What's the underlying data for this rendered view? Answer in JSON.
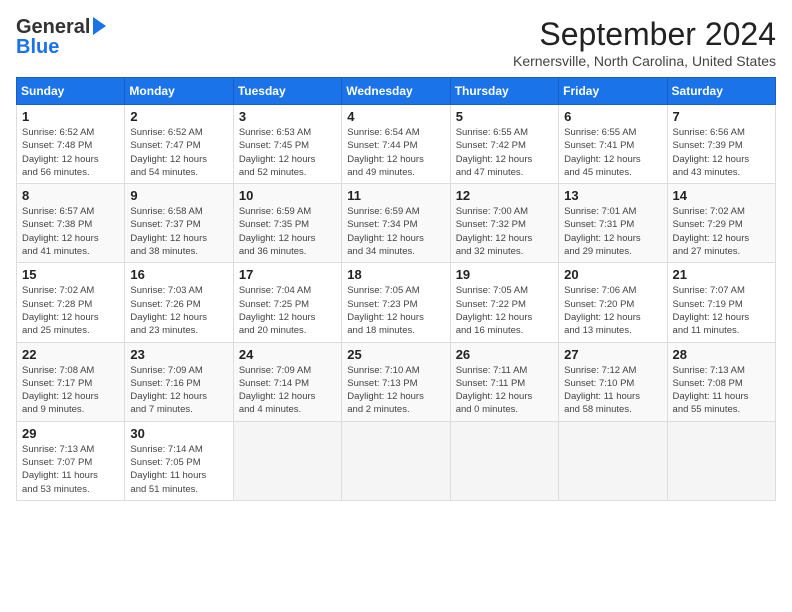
{
  "header": {
    "logo_line1": "General",
    "logo_line2": "Blue",
    "title": "September 2024",
    "subtitle": "Kernersville, North Carolina, United States"
  },
  "calendar": {
    "columns": [
      "Sunday",
      "Monday",
      "Tuesday",
      "Wednesday",
      "Thursday",
      "Friday",
      "Saturday"
    ],
    "weeks": [
      [
        {
          "day": "1",
          "info": "Sunrise: 6:52 AM\nSunset: 7:48 PM\nDaylight: 12 hours\nand 56 minutes."
        },
        {
          "day": "2",
          "info": "Sunrise: 6:52 AM\nSunset: 7:47 PM\nDaylight: 12 hours\nand 54 minutes."
        },
        {
          "day": "3",
          "info": "Sunrise: 6:53 AM\nSunset: 7:45 PM\nDaylight: 12 hours\nand 52 minutes."
        },
        {
          "day": "4",
          "info": "Sunrise: 6:54 AM\nSunset: 7:44 PM\nDaylight: 12 hours\nand 49 minutes."
        },
        {
          "day": "5",
          "info": "Sunrise: 6:55 AM\nSunset: 7:42 PM\nDaylight: 12 hours\nand 47 minutes."
        },
        {
          "day": "6",
          "info": "Sunrise: 6:55 AM\nSunset: 7:41 PM\nDaylight: 12 hours\nand 45 minutes."
        },
        {
          "day": "7",
          "info": "Sunrise: 6:56 AM\nSunset: 7:39 PM\nDaylight: 12 hours\nand 43 minutes."
        }
      ],
      [
        {
          "day": "8",
          "info": "Sunrise: 6:57 AM\nSunset: 7:38 PM\nDaylight: 12 hours\nand 41 minutes."
        },
        {
          "day": "9",
          "info": "Sunrise: 6:58 AM\nSunset: 7:37 PM\nDaylight: 12 hours\nand 38 minutes."
        },
        {
          "day": "10",
          "info": "Sunrise: 6:59 AM\nSunset: 7:35 PM\nDaylight: 12 hours\nand 36 minutes."
        },
        {
          "day": "11",
          "info": "Sunrise: 6:59 AM\nSunset: 7:34 PM\nDaylight: 12 hours\nand 34 minutes."
        },
        {
          "day": "12",
          "info": "Sunrise: 7:00 AM\nSunset: 7:32 PM\nDaylight: 12 hours\nand 32 minutes."
        },
        {
          "day": "13",
          "info": "Sunrise: 7:01 AM\nSunset: 7:31 PM\nDaylight: 12 hours\nand 29 minutes."
        },
        {
          "day": "14",
          "info": "Sunrise: 7:02 AM\nSunset: 7:29 PM\nDaylight: 12 hours\nand 27 minutes."
        }
      ],
      [
        {
          "day": "15",
          "info": "Sunrise: 7:02 AM\nSunset: 7:28 PM\nDaylight: 12 hours\nand 25 minutes."
        },
        {
          "day": "16",
          "info": "Sunrise: 7:03 AM\nSunset: 7:26 PM\nDaylight: 12 hours\nand 23 minutes."
        },
        {
          "day": "17",
          "info": "Sunrise: 7:04 AM\nSunset: 7:25 PM\nDaylight: 12 hours\nand 20 minutes."
        },
        {
          "day": "18",
          "info": "Sunrise: 7:05 AM\nSunset: 7:23 PM\nDaylight: 12 hours\nand 18 minutes."
        },
        {
          "day": "19",
          "info": "Sunrise: 7:05 AM\nSunset: 7:22 PM\nDaylight: 12 hours\nand 16 minutes."
        },
        {
          "day": "20",
          "info": "Sunrise: 7:06 AM\nSunset: 7:20 PM\nDaylight: 12 hours\nand 13 minutes."
        },
        {
          "day": "21",
          "info": "Sunrise: 7:07 AM\nSunset: 7:19 PM\nDaylight: 12 hours\nand 11 minutes."
        }
      ],
      [
        {
          "day": "22",
          "info": "Sunrise: 7:08 AM\nSunset: 7:17 PM\nDaylight: 12 hours\nand 9 minutes."
        },
        {
          "day": "23",
          "info": "Sunrise: 7:09 AM\nSunset: 7:16 PM\nDaylight: 12 hours\nand 7 minutes."
        },
        {
          "day": "24",
          "info": "Sunrise: 7:09 AM\nSunset: 7:14 PM\nDaylight: 12 hours\nand 4 minutes."
        },
        {
          "day": "25",
          "info": "Sunrise: 7:10 AM\nSunset: 7:13 PM\nDaylight: 12 hours\nand 2 minutes."
        },
        {
          "day": "26",
          "info": "Sunrise: 7:11 AM\nSunset: 7:11 PM\nDaylight: 12 hours\nand 0 minutes."
        },
        {
          "day": "27",
          "info": "Sunrise: 7:12 AM\nSunset: 7:10 PM\nDaylight: 11 hours\nand 58 minutes."
        },
        {
          "day": "28",
          "info": "Sunrise: 7:13 AM\nSunset: 7:08 PM\nDaylight: 11 hours\nand 55 minutes."
        }
      ],
      [
        {
          "day": "29",
          "info": "Sunrise: 7:13 AM\nSunset: 7:07 PM\nDaylight: 11 hours\nand 53 minutes."
        },
        {
          "day": "30",
          "info": "Sunrise: 7:14 AM\nSunset: 7:05 PM\nDaylight: 11 hours\nand 51 minutes."
        },
        {
          "day": "",
          "info": ""
        },
        {
          "day": "",
          "info": ""
        },
        {
          "day": "",
          "info": ""
        },
        {
          "day": "",
          "info": ""
        },
        {
          "day": "",
          "info": ""
        }
      ]
    ]
  }
}
